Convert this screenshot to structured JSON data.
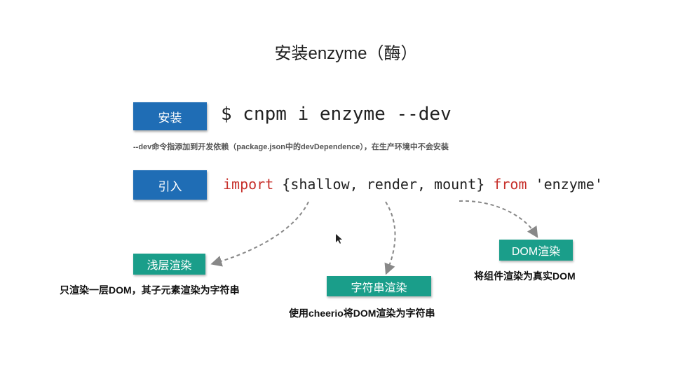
{
  "title": "安装enzyme（酶）",
  "install": {
    "label": "安装",
    "command": "$ cnpm i enzyme --dev",
    "note": "--dev命令指添加到开发依赖（package.json中的devDependence），在生产环境中不会安装"
  },
  "import": {
    "label": "引入",
    "keyword_import": "import",
    "body": " {shallow, render, mount} ",
    "keyword_from": "from",
    "module": " 'enzyme'"
  },
  "renders": [
    {
      "label": "浅层渲染",
      "desc": "只渲染一层DOM，其子元素渲染为字符串"
    },
    {
      "label": "字符串渲染",
      "desc": "使用cheerio将DOM渲染为字符串"
    },
    {
      "label": "DOM渲染",
      "desc": "将组件渲染为真实DOM"
    }
  ],
  "colors": {
    "blue": "#1f6db5",
    "teal": "#1a9e8a",
    "keyword": "#c7312c"
  }
}
